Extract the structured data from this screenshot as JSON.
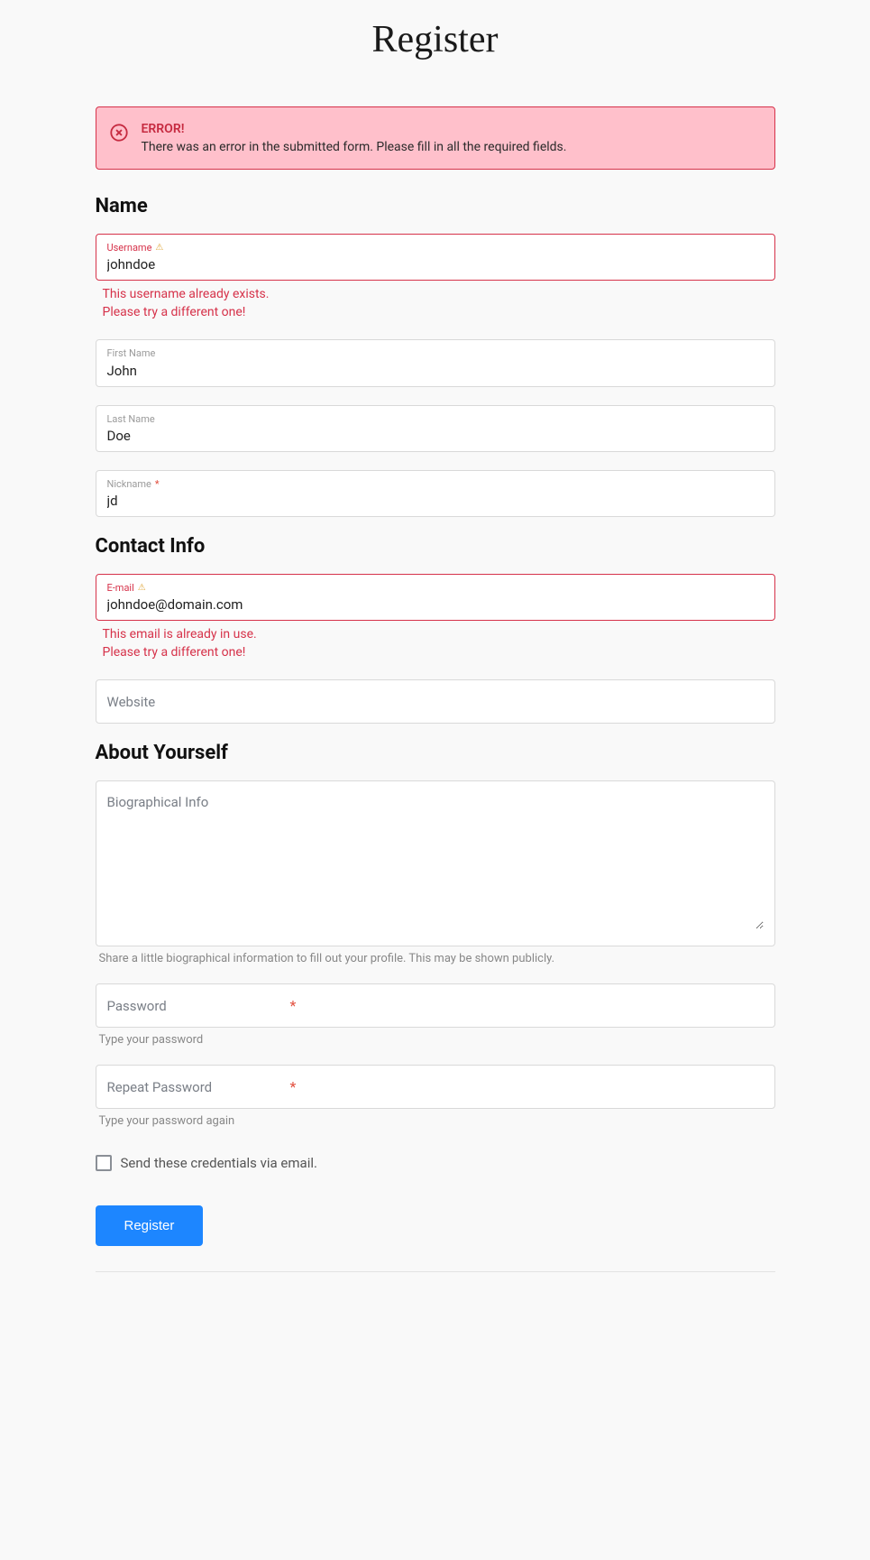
{
  "page": {
    "title": "Register"
  },
  "alert": {
    "title": "ERROR!",
    "message": "There was an error in the submitted form. Please fill in all the required fields."
  },
  "sections": {
    "name": "Name",
    "contact": "Contact Info",
    "about": "About Yourself"
  },
  "fields": {
    "username": {
      "label": "Username",
      "value": "johndoe",
      "error_line1": "This username already exists.",
      "error_line2": "Please try a different one!"
    },
    "first_name": {
      "label": "First Name",
      "value": "John"
    },
    "last_name": {
      "label": "Last Name",
      "value": "Doe"
    },
    "nickname": {
      "label": "Nickname",
      "value": "jd"
    },
    "email": {
      "label": "E-mail",
      "value": "johndoe@domain.com",
      "error_line1": "This email is already in use.",
      "error_line2": "Please try a different one!"
    },
    "website": {
      "placeholder": "Website",
      "value": ""
    },
    "bio": {
      "placeholder": "Biographical Info",
      "value": "",
      "help": "Share a little biographical information to fill out your profile. This may be shown publicly."
    },
    "password": {
      "placeholder": "Password",
      "value": "",
      "help": "Type your password"
    },
    "repeat_password": {
      "placeholder": "Repeat Password",
      "value": "",
      "help": "Type your password again"
    }
  },
  "checkbox": {
    "label": "Send these credentials via email."
  },
  "submit": {
    "label": "Register"
  }
}
